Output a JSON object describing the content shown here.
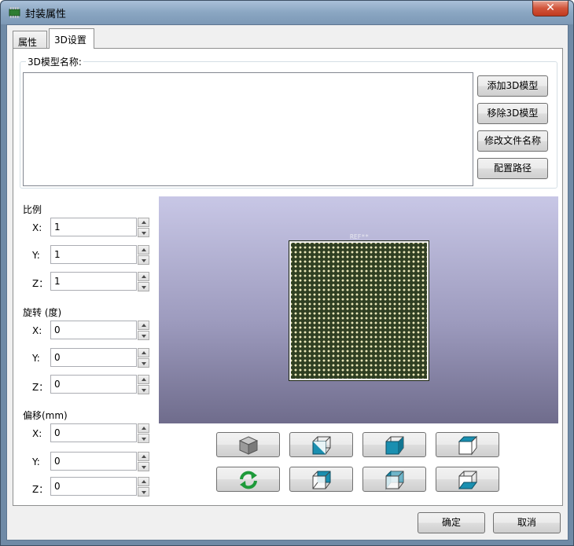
{
  "window": {
    "title": "封装属性",
    "close_label": "✕"
  },
  "tabs": [
    {
      "label": "属性",
      "active": false
    },
    {
      "label": "3D设置",
      "active": true
    }
  ],
  "model_group": {
    "title": "3D模型名称:",
    "items": [],
    "buttons": {
      "add": "添加3D模型",
      "remove": "移除3D模型",
      "rename": "修改文件名称",
      "path": "配置路径"
    }
  },
  "scale": {
    "label": "比例",
    "x_label": "X:",
    "x_value": "1",
    "y_label": "Y:",
    "y_value": "1",
    "z_label": "Z：",
    "z_value": "1"
  },
  "rotation": {
    "label": "旋转 (度)",
    "x_label": "X:",
    "x_value": "0",
    "y_label": "Y:",
    "y_value": "0",
    "z_label": "Z：",
    "z_value": "0"
  },
  "offset": {
    "label": "偏移(mm)",
    "x_label": "X:",
    "x_value": "0",
    "y_label": "Y:",
    "y_value": "0",
    "z_label": "Z：",
    "z_value": "0"
  },
  "viewport": {
    "ref_label": "REF**",
    "background_top": "#c8c7e6",
    "background_bottom": "#6f6c8c",
    "board_color": "#2f3f22",
    "pad_color": "#e9e6b8"
  },
  "view_buttons": [
    {
      "icon": "iso-cube-icon"
    },
    {
      "icon": "view-front-icon"
    },
    {
      "icon": "view-right-icon"
    },
    {
      "icon": "view-top-icon"
    },
    {
      "icon": "reset-rotate-icon"
    },
    {
      "icon": "view-back-icon"
    },
    {
      "icon": "view-left-icon"
    },
    {
      "icon": "view-bottom-icon"
    }
  ],
  "footer": {
    "ok": "确定",
    "cancel": "取消"
  },
  "colors": {
    "accent_cube": "#1a8fb0",
    "close_button": "#c13a20"
  }
}
